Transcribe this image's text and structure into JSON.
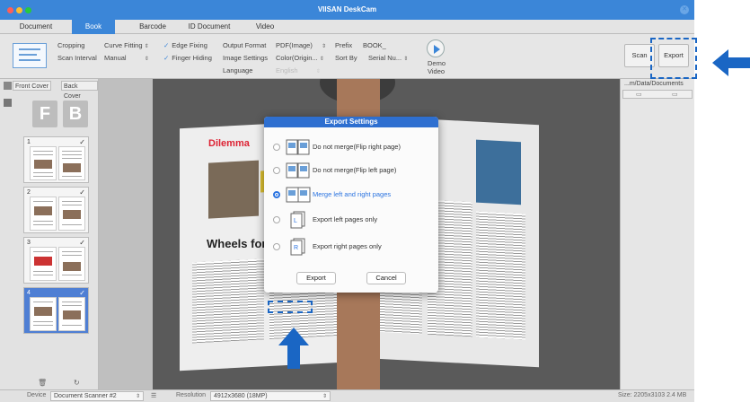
{
  "app": {
    "title": "VIISAN DeskCam"
  },
  "tabs": [
    {
      "label": "Document"
    },
    {
      "label": "Book"
    },
    {
      "label": "Barcode"
    },
    {
      "label": "ID Document"
    },
    {
      "label": "Video"
    }
  ],
  "toolbar": {
    "cropping": "Cropping",
    "scan_interval": "Scan Interval",
    "curve_fitting": "Curve Fitting",
    "curve_mode": "Manual",
    "edge_fixing": "Edge Fixing",
    "finger_hiding": "Finger Hiding",
    "output_format_label": "Output Format",
    "output_format_value": "PDF(Image)",
    "image_settings_label": "Image Settings",
    "image_settings_value": "Color(Origin...",
    "language_label": "Language",
    "language_value": "English",
    "prefix_label": "Prefix",
    "prefix_value": "BOOK_",
    "sort_by_label": "Sort By",
    "sort_by_value": "Serial Nu...",
    "demo_video": "Demo\nVideo",
    "scan": "Scan",
    "export": "Export"
  },
  "left_panel": {
    "front_cover": "Front Cover",
    "back_cover": "Back Cover",
    "f_letter": "F",
    "b_letter": "B",
    "thumbs": [
      {
        "num": "1",
        "checked": true
      },
      {
        "num": "2",
        "checked": true
      },
      {
        "num": "3",
        "checked": true
      },
      {
        "num": "4",
        "checked": true
      }
    ]
  },
  "right_panel": {
    "path": "...m/Data/Documents"
  },
  "status": {
    "device_label": "Device",
    "device_value": "Document Scanner #2",
    "resolution_label": "Resolution",
    "resolution_value": "4912x3680 (18MP)",
    "size": "Size: 2205x3103 2.4 MB"
  },
  "dialog": {
    "title": "Export Settings",
    "options": [
      {
        "label": "Do not merge(Flip right page)",
        "selected": false
      },
      {
        "label": "Do not merge(Flip left page)",
        "selected": false
      },
      {
        "label": "Merge left and right pages",
        "selected": true
      },
      {
        "label": "Export left pages only",
        "selected": false
      },
      {
        "label": "Export right pages only",
        "selected": false
      }
    ],
    "export_button": "Export",
    "cancel_button": "Cancel"
  },
  "book": {
    "heading1": "Dilemma",
    "heading2": "Wheels for Wa"
  },
  "colors": {
    "accent": "#3b86d8",
    "dialog_title": "#2e6fd0",
    "annotation": "#1a66c4"
  }
}
